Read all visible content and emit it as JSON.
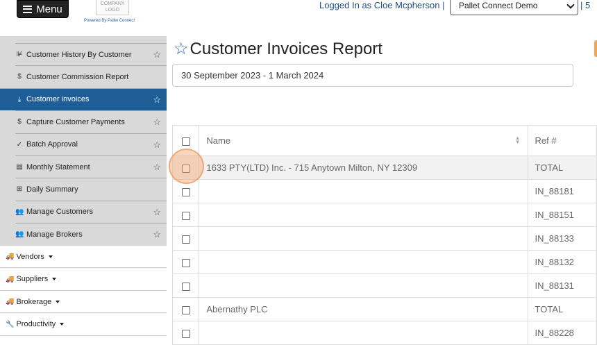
{
  "header": {
    "menu_label": "Menu",
    "logo_text": "COMPANY LOGO",
    "powered_by": "Powered By Pallet Connect",
    "logged_in": "Logged In as Cloe Mcpherson",
    "separator": "|",
    "company": "Pallet Connect Demo",
    "tail": "| 5"
  },
  "sidebar": {
    "sub_items": [
      {
        "label": "Customer History By Customer",
        "icon": "chart-icon",
        "glyph": "⊯",
        "star": true
      },
      {
        "label": "Customer Commission Report",
        "icon": "dollar-icon",
        "glyph": "$",
        "star": false
      },
      {
        "label": "Customer invoices",
        "icon": "download-icon",
        "glyph": "⤓",
        "star": true,
        "active": true
      },
      {
        "label": "Capture Customer Payments",
        "icon": "dollar-icon",
        "glyph": "$",
        "star": true
      },
      {
        "label": "Batch Approval",
        "icon": "check-icon",
        "glyph": "✓",
        "star": true
      },
      {
        "label": "Monthly Statement",
        "icon": "statement-icon",
        "glyph": "▤",
        "star": true
      },
      {
        "label": "Daily Summary",
        "icon": "table-icon",
        "glyph": "⊞",
        "star": false
      },
      {
        "label": "Manage Customers",
        "icon": "users-icon",
        "glyph": "👥",
        "star": true
      },
      {
        "label": "Manage Brokers",
        "icon": "users-icon",
        "glyph": "👥",
        "star": true
      }
    ],
    "main_items": [
      {
        "label": "Vendors",
        "icon": "truck-icon",
        "glyph": "🚚"
      },
      {
        "label": "Suppliers",
        "icon": "truck-icon",
        "glyph": "🚚"
      },
      {
        "label": "Brokerage",
        "icon": "truck-icon",
        "glyph": "🚚"
      },
      {
        "label": "Productivity",
        "icon": "wrench-icon",
        "glyph": "🔧"
      }
    ]
  },
  "page": {
    "title": "Customer Invoices Report",
    "date_range": "30 September 2023 - 1 March 2024"
  },
  "table": {
    "headers": [
      "",
      "Name",
      "Ref #"
    ],
    "rows": [
      {
        "name": "1633 PTY(LTD) Inc. - 715 Anytown Milton, NY 12309",
        "ref": "TOTAL",
        "highlight": true
      },
      {
        "name": "",
        "ref": "IN_88181"
      },
      {
        "name": "",
        "ref": "IN_88151"
      },
      {
        "name": "",
        "ref": "IN_88133"
      },
      {
        "name": "",
        "ref": "IN_88132"
      },
      {
        "name": "",
        "ref": "IN_88131"
      },
      {
        "name": "Abernathy PLC",
        "ref": "TOTAL"
      },
      {
        "name": "",
        "ref": "IN_88228"
      }
    ]
  },
  "colors": {
    "active": "#1f5d97",
    "accent": "#f0a55a",
    "star": "#2a6ac9"
  }
}
